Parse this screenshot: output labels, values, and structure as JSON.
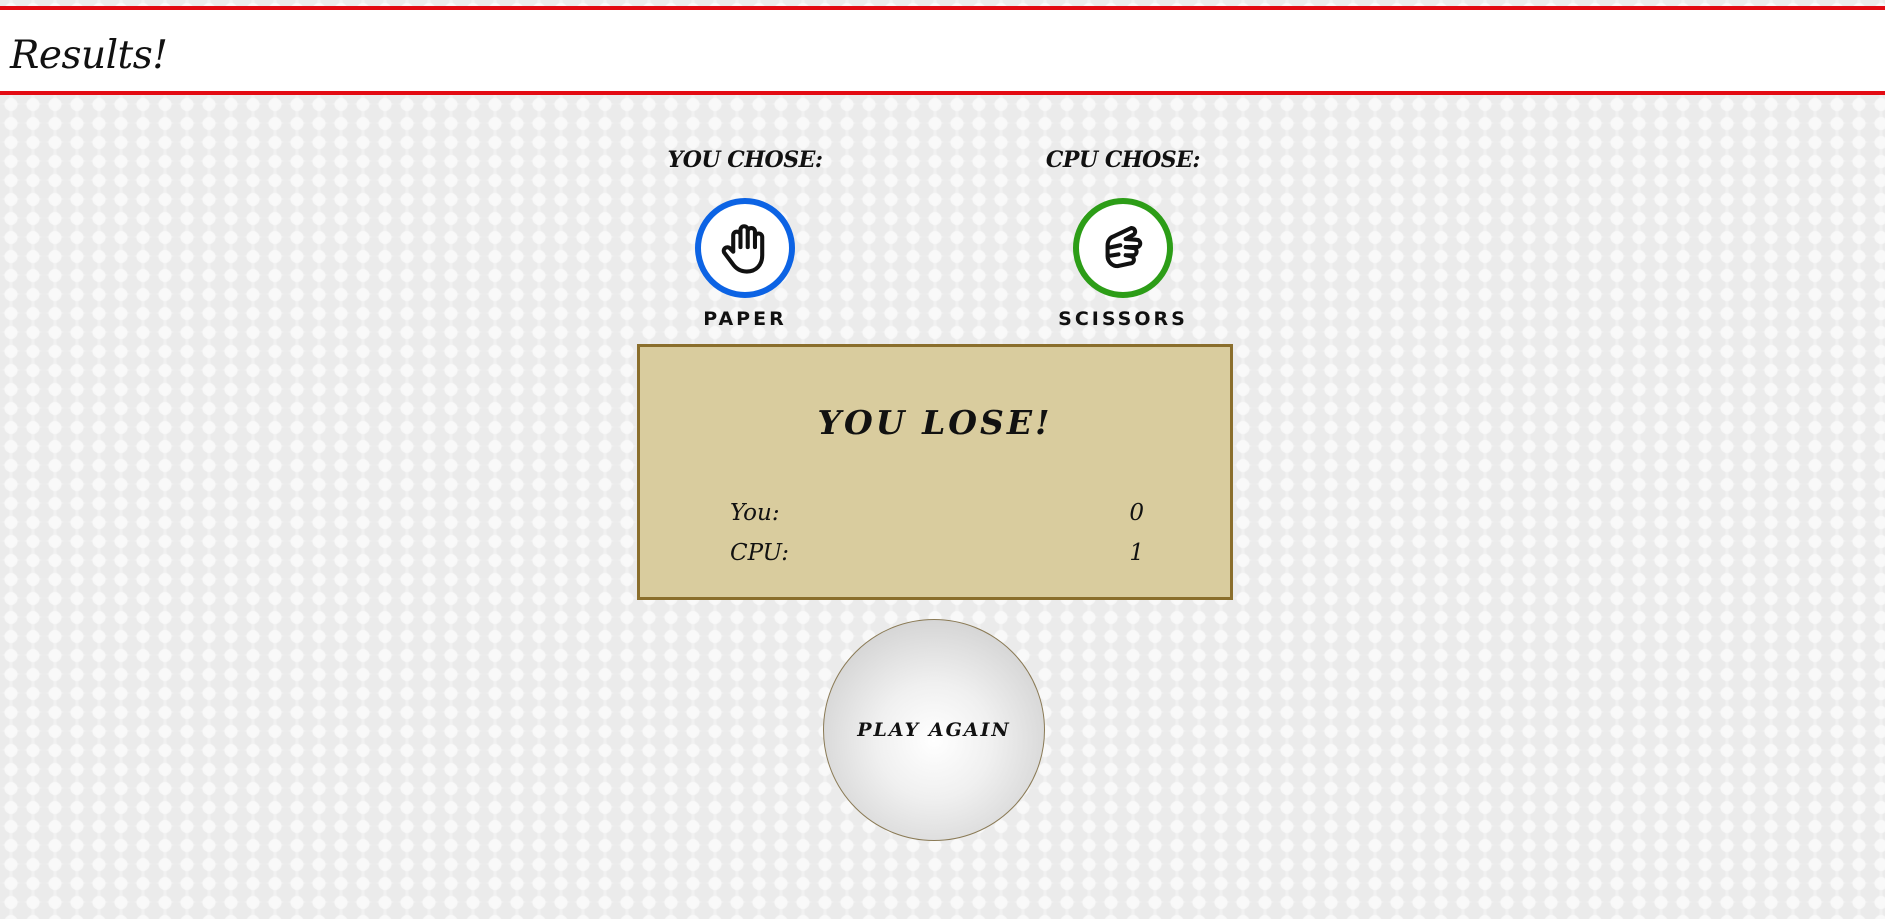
{
  "header": {
    "title": "Results!"
  },
  "player": {
    "heading": "YOU CHOSE:",
    "choice": "PAPER",
    "icon": "hand-paper-icon",
    "ring_color": "#0c63e4"
  },
  "cpu": {
    "heading": "CPU CHOSE:",
    "choice": "SCISSORS",
    "icon": "hand-scissors-icon",
    "ring_color": "#2c9d17"
  },
  "result": {
    "message": "YOU LOSE!",
    "scores": [
      {
        "label": "You:",
        "value": "0"
      },
      {
        "label": "CPU:",
        "value": "1"
      }
    ]
  },
  "actions": {
    "play_again_label": "PLAY AGAIN"
  },
  "colors": {
    "header_border": "#e30b13",
    "result_box_bg": "#d9cc9e",
    "result_box_border": "#8a6e2c"
  }
}
